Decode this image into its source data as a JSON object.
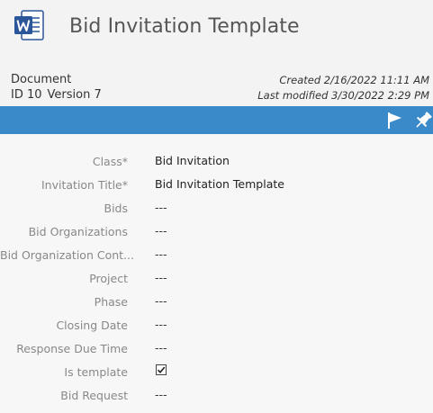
{
  "header": {
    "title": "Bid Invitation Template",
    "doc_type": "Document",
    "id_label": "ID 10",
    "version_label": "Version 7",
    "created": "Created 2/16/2022 11:11 AM",
    "modified": "Last modified 3/30/2022 2:29 PM",
    "file_icon": "word-icon"
  },
  "toolbar": {
    "accent_color": "#3a89c9",
    "icons": [
      "flag-icon",
      "pin-icon"
    ]
  },
  "properties": [
    {
      "label": "Class*",
      "value": "Bid Invitation"
    },
    {
      "label": "Invitation Title*",
      "value": "Bid Invitation Template"
    },
    {
      "label": "Bids",
      "value": "---"
    },
    {
      "label": "Bid Organizations",
      "value": "---"
    },
    {
      "label": "Bid Organization Cont...",
      "value": "---"
    },
    {
      "label": "Project",
      "value": "---"
    },
    {
      "label": "Phase",
      "value": "---"
    },
    {
      "label": "Closing Date",
      "value": "---"
    },
    {
      "label": "Response Due Time",
      "value": "---"
    },
    {
      "label": "Is template",
      "value": "checked"
    },
    {
      "label": "Bid Request",
      "value": "---"
    }
  ]
}
